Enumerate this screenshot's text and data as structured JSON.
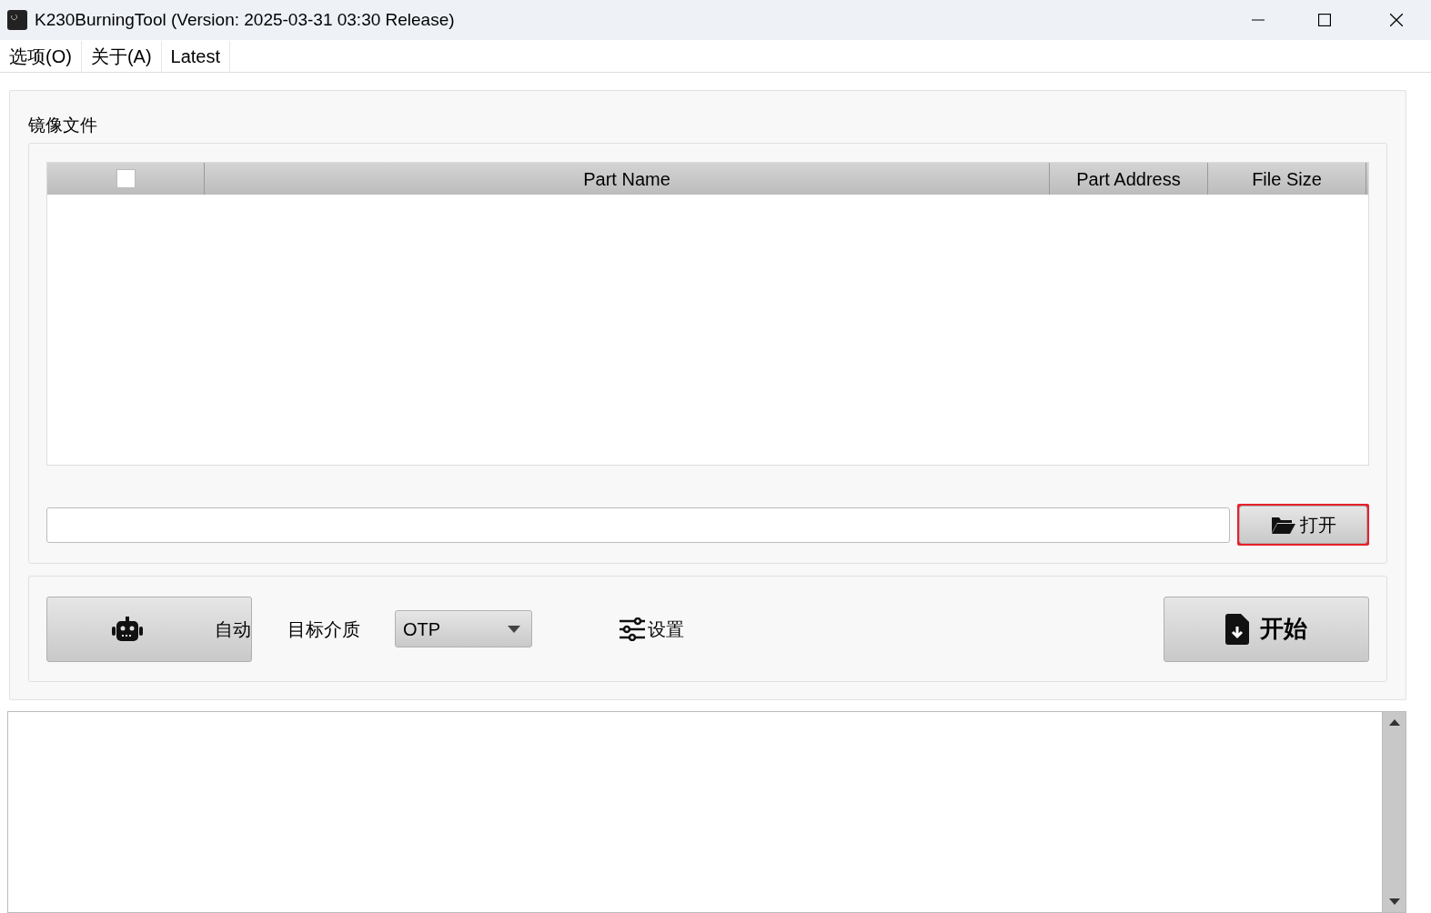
{
  "window": {
    "title": "K230BurningTool (Version: 2025-03-31 03:30 Release)"
  },
  "menu": [
    {
      "label": "选项(O)"
    },
    {
      "label": "关于(A)"
    },
    {
      "label": "Latest"
    }
  ],
  "image_files": {
    "title": "镜像文件",
    "select_all": {
      "checked": false
    },
    "columns": [
      "Part Name",
      "Part Address",
      "File Size"
    ],
    "open_button": {
      "label": "打开",
      "focused": true
    }
  },
  "controls": {
    "auto_button": "自动",
    "medium_label": "目标介质",
    "medium": {
      "value": "OTP"
    },
    "settings": "设置",
    "start_button": "开始"
  }
}
